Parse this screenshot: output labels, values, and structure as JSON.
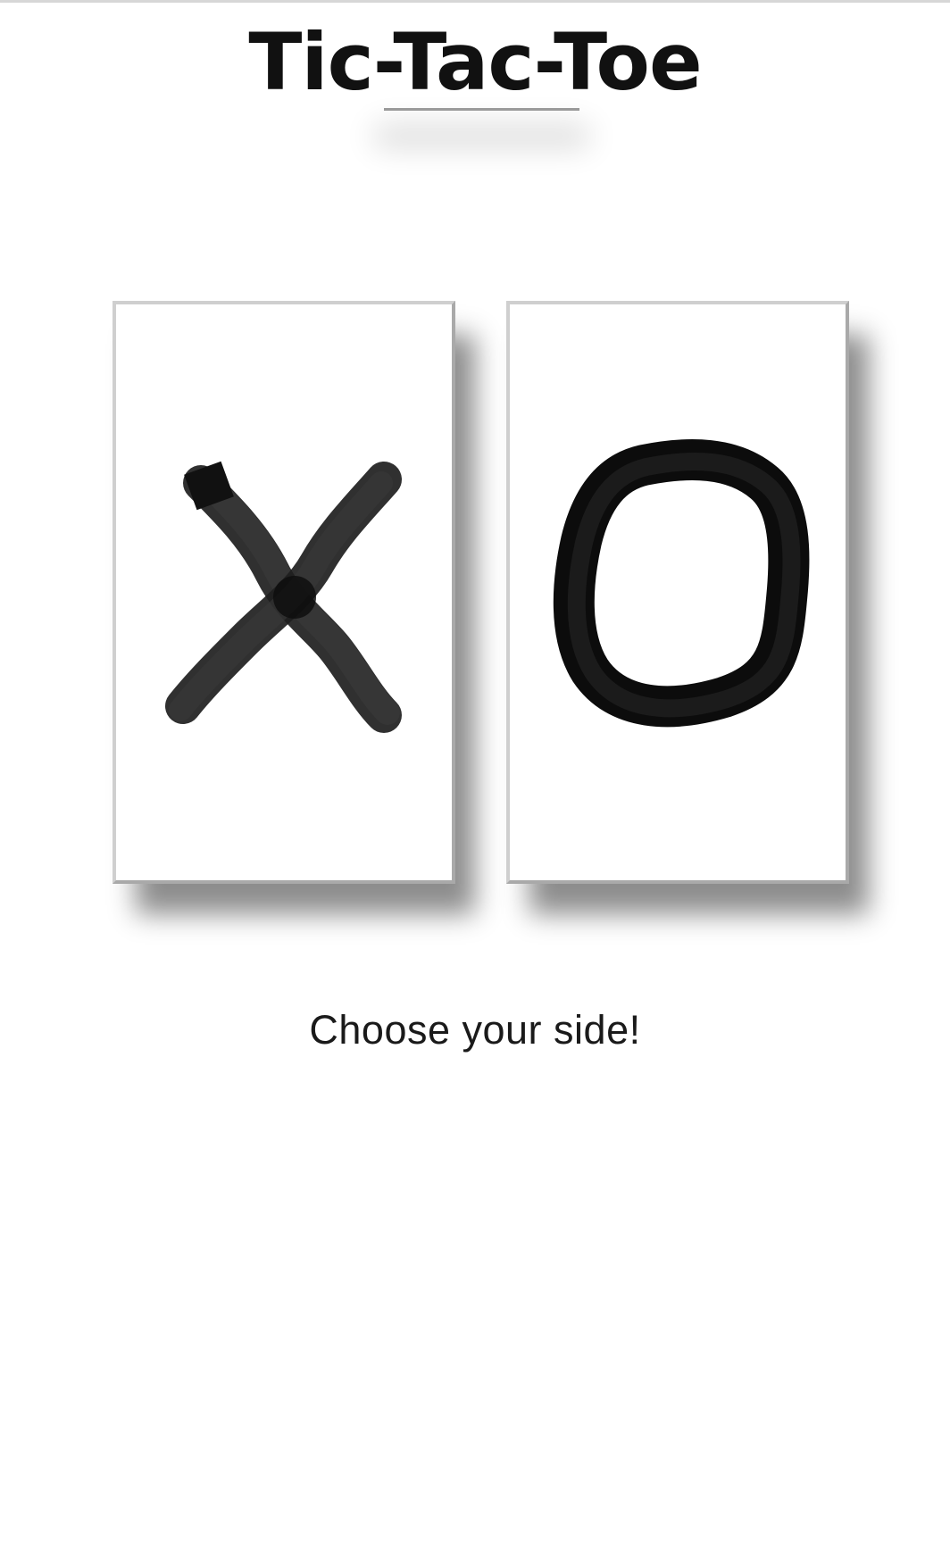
{
  "app": {
    "title": "Tic-Tac-Toe"
  },
  "choices": [
    {
      "symbol": "X",
      "icon": "brush-x-icon"
    },
    {
      "symbol": "O",
      "icon": "brush-o-icon"
    }
  ],
  "prompt": {
    "text": "Choose your side!"
  },
  "colors": {
    "background": "#ffffff",
    "ink": "#111111"
  }
}
